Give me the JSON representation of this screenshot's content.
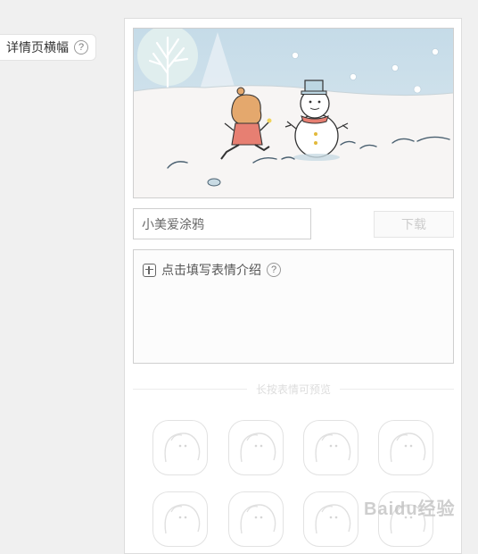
{
  "sidebar": {
    "label": "详情页横幅",
    "help": "?"
  },
  "form": {
    "name_value": "小美爱涂鸦",
    "download_label": "下载",
    "intro_label": "点击填写表情介绍",
    "intro_help": "?",
    "preview_hint": "长按表情可预览"
  },
  "watermark": "Baidu经验",
  "colors": {
    "sky": "#c9dde9",
    "snow": "#f7f5f4",
    "scarf": "#e77f72"
  },
  "icons": [
    "help-icon",
    "plus-icon",
    "sticker-placeholder-icon"
  ]
}
